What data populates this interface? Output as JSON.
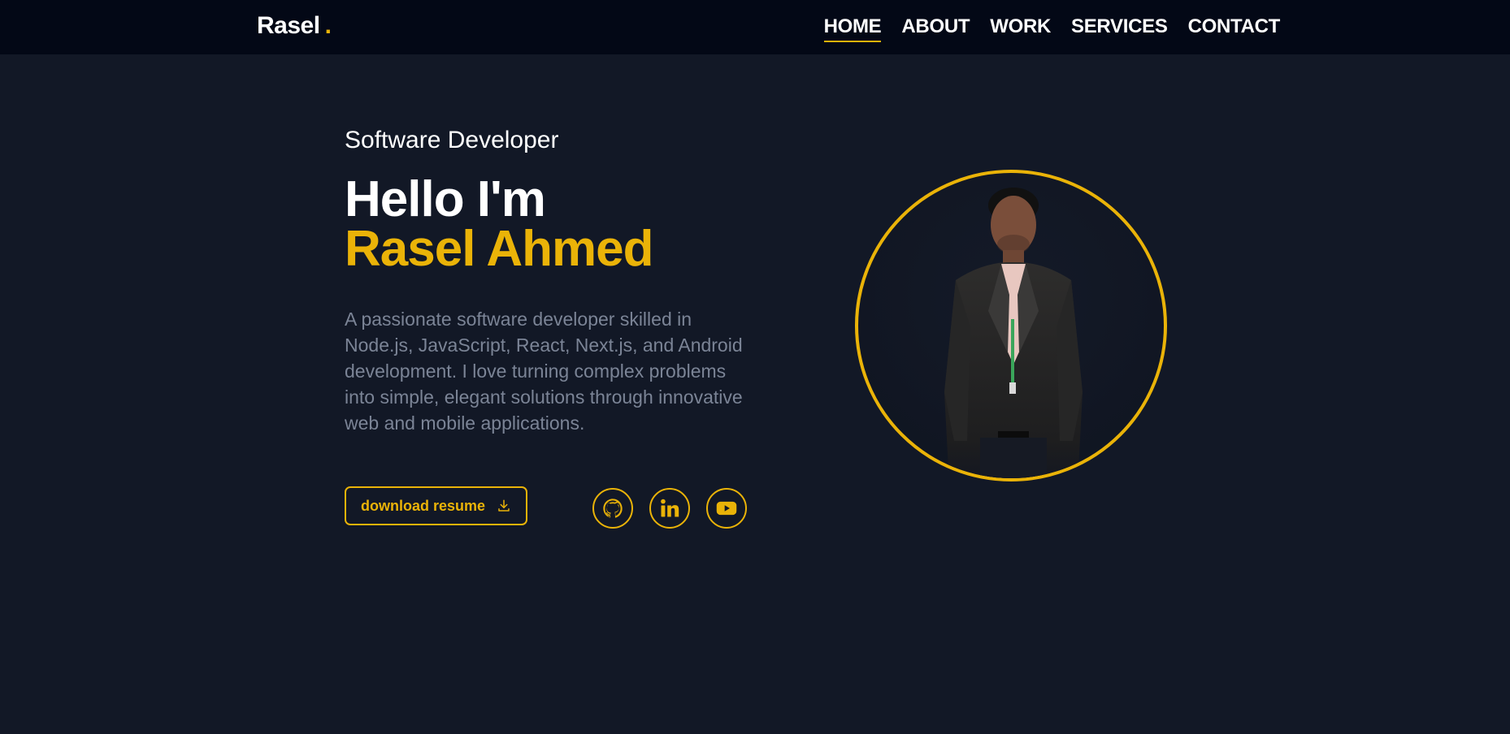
{
  "nav": {
    "brand": "Rasel",
    "brand_dot": ".",
    "links": [
      {
        "label": "HOME",
        "active": true
      },
      {
        "label": "ABOUT",
        "active": false
      },
      {
        "label": "WORK",
        "active": false
      },
      {
        "label": "SERVICES",
        "active": false
      },
      {
        "label": "CONTACT",
        "active": false
      }
    ]
  },
  "hero": {
    "role": "Software Developer",
    "greeting": "Hello I'm",
    "name": "Rasel Ahmed",
    "bio": "A passionate software developer skilled in Node.js, JavaScript, React, Next.js, and Android development. I love turning complex problems into simple, elegant solutions through innovative web and mobile applications.",
    "resume_label": "download resume",
    "resume_icon": "download-icon",
    "socials": [
      {
        "name": "github",
        "icon": "github-icon"
      },
      {
        "name": "linkedin",
        "icon": "linkedin-icon"
      },
      {
        "name": "youtube",
        "icon": "youtube-icon"
      }
    ],
    "portrait": "profile-photo"
  },
  "colors": {
    "accent": "#eab308",
    "background": "#121826",
    "navbar": "#030816",
    "muted_text": "#7b8496",
    "text": "#ffffff"
  }
}
